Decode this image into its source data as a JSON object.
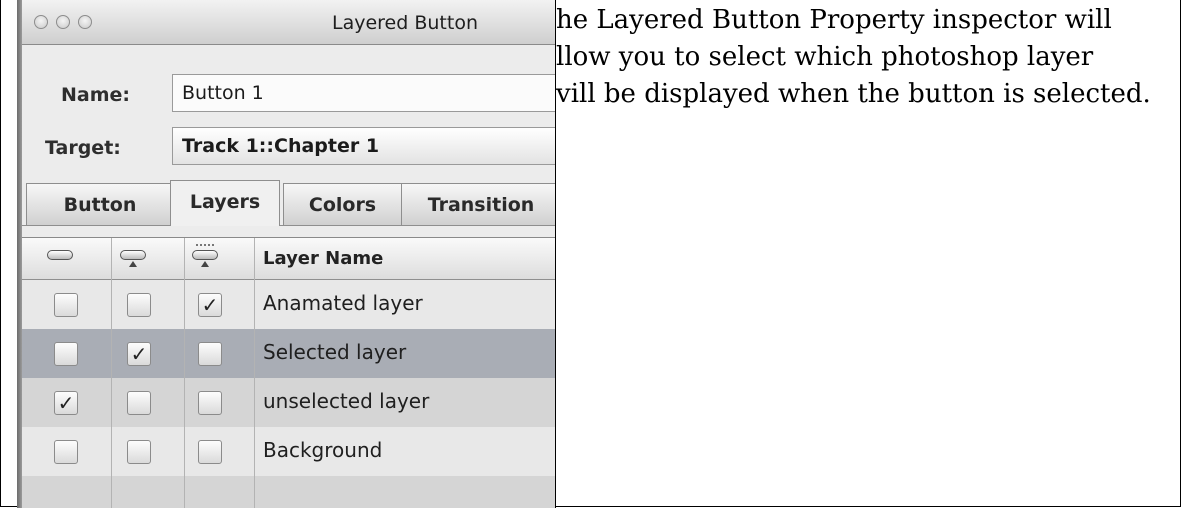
{
  "window": {
    "title": "Layered Button"
  },
  "form": {
    "name_label": "Name:",
    "name_value": "Button 1",
    "target_label": "Target:",
    "target_value": "Track 1::Chapter 1"
  },
  "tabs": [
    {
      "label": "Button",
      "active": false
    },
    {
      "label": "Layers",
      "active": true
    },
    {
      "label": "Colors",
      "active": false
    },
    {
      "label": "Transition",
      "active": false
    }
  ],
  "table": {
    "header_icons": [
      "normal-state-icon",
      "selected-state-icon",
      "activated-state-icon"
    ],
    "layer_name_header": "Layer Name",
    "rows": [
      {
        "name": "Anamated layer",
        "normal": false,
        "selected": false,
        "activated": true
      },
      {
        "name": "Selected layer",
        "normal": false,
        "selected": true,
        "activated": false
      },
      {
        "name": "unselected layer",
        "normal": true,
        "selected": false,
        "activated": false
      },
      {
        "name": "Background",
        "normal": false,
        "selected": false,
        "activated": false
      }
    ]
  },
  "caption": {
    "lines": [
      "he Layered Button Property inspector will",
      "llow you to select which photoshop layer",
      "vill be displayed when the button is selected."
    ]
  },
  "glyphs": {
    "check": "✓"
  }
}
